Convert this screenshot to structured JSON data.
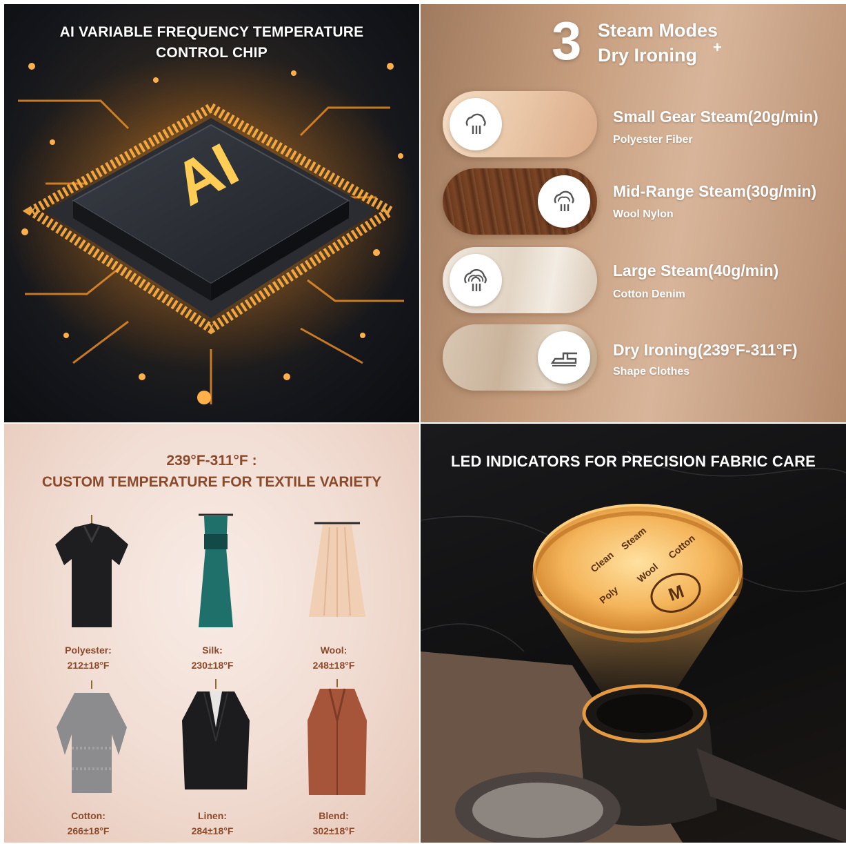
{
  "chip_panel": {
    "title_line1": "AI VARIABLE FREQUENCY TEMPERATURE",
    "title_line2": "CONTROL CHIP",
    "chip_label": "AI",
    "accent": "#ff9a2a"
  },
  "modes_panel": {
    "number": "3",
    "heading_line1": "Steam Modes",
    "heading_line2": "Dry Ironing",
    "plus": "+",
    "modes": [
      {
        "title": "Small Gear Steam(20g/min)",
        "subtitle": "Polyester Fiber",
        "icon": "steam-small-icon"
      },
      {
        "title": "Mid-Range Steam(30g/min)",
        "subtitle": "Wool Nylon",
        "icon": "steam-mid-icon"
      },
      {
        "title": "Large Steam(40g/min)",
        "subtitle": "Cotton Denim",
        "icon": "steam-large-icon"
      },
      {
        "title": "Dry Ironing(239°F-311°F)",
        "subtitle": "Shape Clothes",
        "icon": "iron-icon"
      }
    ]
  },
  "temp_panel": {
    "heading_line1": "239°F-311°F :",
    "heading_line2": "CUSTOM TEMPERATURE FOR TEXTILE VARIETY",
    "garments": [
      {
        "name": "Polyester:",
        "temp": "212±18°F"
      },
      {
        "name": "Silk:",
        "temp": "230±18°F"
      },
      {
        "name": "Wool:",
        "temp": "248±18°F"
      },
      {
        "name": "Cotton:",
        "temp": "266±18°F"
      },
      {
        "name": "Linen:",
        "temp": "284±18°F"
      },
      {
        "name": "Blend:",
        "temp": "302±18°F"
      }
    ]
  },
  "led_panel": {
    "title": "LED INDICATORS FOR PRECISION FABRIC CARE",
    "indicators": {
      "clean": "Clean",
      "steam": "Steam",
      "cotton": "Cotton",
      "wool": "Wool",
      "poly": "Poly",
      "mode_button": "M"
    }
  }
}
